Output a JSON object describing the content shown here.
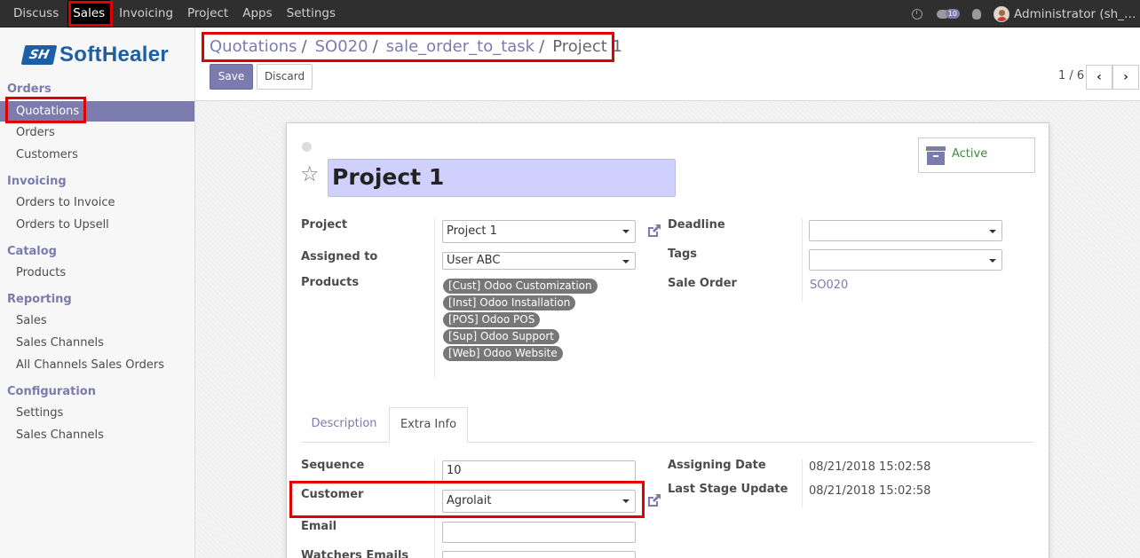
{
  "topbar": {
    "menu": [
      "Discuss",
      "Sales",
      "Invoicing",
      "Project",
      "Apps",
      "Settings"
    ],
    "active_menu": "Sales",
    "messages_badge": "10",
    "user": "Administrator (sh_so_task)"
  },
  "logo": {
    "mark": "SH",
    "text": "SoftHealer"
  },
  "sidebar": {
    "sections": [
      {
        "title": "Orders",
        "items": [
          "Quotations",
          "Orders",
          "Customers"
        ]
      },
      {
        "title": "Invoicing",
        "items": [
          "Orders to Invoice",
          "Orders to Upsell"
        ]
      },
      {
        "title": "Catalog",
        "items": [
          "Products"
        ]
      },
      {
        "title": "Reporting",
        "items": [
          "Sales",
          "Sales Channels",
          "All Channels Sales Orders"
        ]
      },
      {
        "title": "Configuration",
        "items": [
          "Settings",
          "Sales Channels"
        ]
      }
    ],
    "active_item": "Quotations"
  },
  "breadcrumb": [
    "Quotations",
    "SO020",
    "sale_order_to_task",
    "Project 1"
  ],
  "buttons": {
    "save": "Save",
    "discard": "Discard"
  },
  "pager": {
    "value": "1 / 6"
  },
  "form": {
    "title": "Project 1",
    "active_label": "Active",
    "project_label": "Project",
    "project_value": "Project 1",
    "assigned_label": "Assigned to",
    "assigned_value": "User ABC",
    "products_label": "Products",
    "products": [
      "[Cust] Odoo Customization",
      "[Inst] Odoo Installation",
      "[POS] Odoo POS",
      "[Sup] Odoo Support",
      "[Web] Odoo Website"
    ],
    "deadline_label": "Deadline",
    "deadline_value": "",
    "tags_label": "Tags",
    "sale_order_label": "Sale Order",
    "sale_order_value": "SO020",
    "tabs": [
      "Description",
      "Extra Info"
    ],
    "active_tab": "Extra Info",
    "sequence_label": "Sequence",
    "sequence_value": "10",
    "customer_label": "Customer",
    "customer_value": "Agrolait",
    "email_label": "Email",
    "email_value": "",
    "watchers_label": "Watchers Emails",
    "assigning_date_label": "Assigning Date",
    "assigning_date_value": "08/21/2018 15:02:58",
    "last_stage_label": "Last Stage Update",
    "last_stage_value": "08/21/2018 15:02:58"
  },
  "colors": {
    "brand": "#7c7bad",
    "highlight": "#e00000",
    "logo": "#1b5fa5"
  }
}
